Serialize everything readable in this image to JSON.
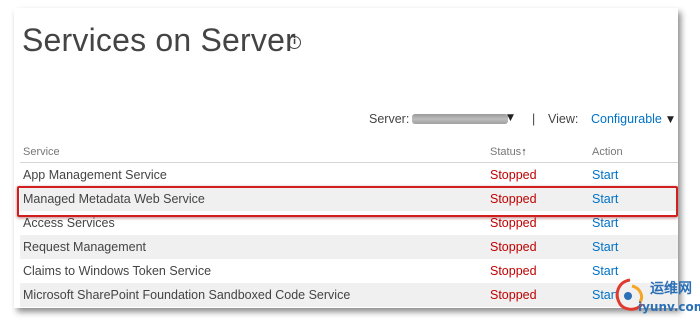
{
  "page": {
    "title": "Services on Server"
  },
  "toolbar": {
    "server_label": "Server:",
    "separator": "|",
    "view_label": "View:",
    "view_value": "Configurable"
  },
  "grid": {
    "headers": {
      "service": "Service",
      "status": "Status",
      "status_sort_indicator": "↑",
      "action": "Action"
    },
    "rows": [
      {
        "service": "App Management Service",
        "status": "Stopped",
        "action": "Start"
      },
      {
        "service": "Managed Metadata Web Service",
        "status": "Stopped",
        "action": "Start"
      },
      {
        "service": "Access Services",
        "status": "Stopped",
        "action": "Start"
      },
      {
        "service": "Request Management",
        "status": "Stopped",
        "action": "Start"
      },
      {
        "service": "Claims to Windows Token Service",
        "status": "Stopped",
        "action": "Start"
      },
      {
        "service": "Microsoft SharePoint Foundation Sandboxed Code Service",
        "status": "Stopped",
        "action": "Start"
      }
    ]
  },
  "colors": {
    "status_stopped": "#c00000",
    "link": "#0072c6",
    "highlight_border": "#d11e1e"
  },
  "watermark": {
    "cn": "运维网",
    "en": "iyunv.com"
  }
}
